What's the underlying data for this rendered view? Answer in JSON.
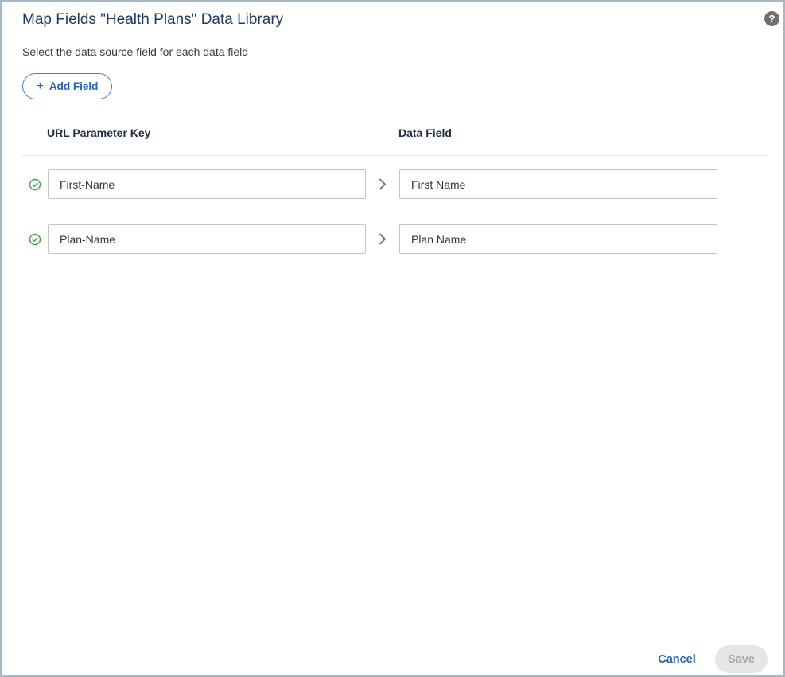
{
  "dialog": {
    "title": "Map Fields \"Health Plans\" Data Library",
    "subtitle": "Select the data source field for each data field",
    "help_icon": "question-circle-icon",
    "help_glyph": "?"
  },
  "toolbar": {
    "add_field_label": "Add Field",
    "add_field_icon": "plus-icon",
    "add_field_glyph": "+"
  },
  "columns": {
    "key_header": "URL Parameter Key",
    "field_header": "Data Field"
  },
  "mappings": [
    {
      "status_icon": "check-circle-icon",
      "key_value": "First-Name",
      "arrow_icon": "chevron-right-icon",
      "field_value": "First Name"
    },
    {
      "status_icon": "check-circle-icon",
      "key_value": "Plan-Name",
      "arrow_icon": "chevron-right-icon",
      "field_value": "Plan Name"
    }
  ],
  "footer": {
    "cancel_label": "Cancel",
    "save_label": "Save",
    "save_disabled": true
  },
  "colors": {
    "accent": "#1d63c4",
    "success": "#3aa64c",
    "title": "#1f3b64",
    "border": "#a6b7c6"
  }
}
